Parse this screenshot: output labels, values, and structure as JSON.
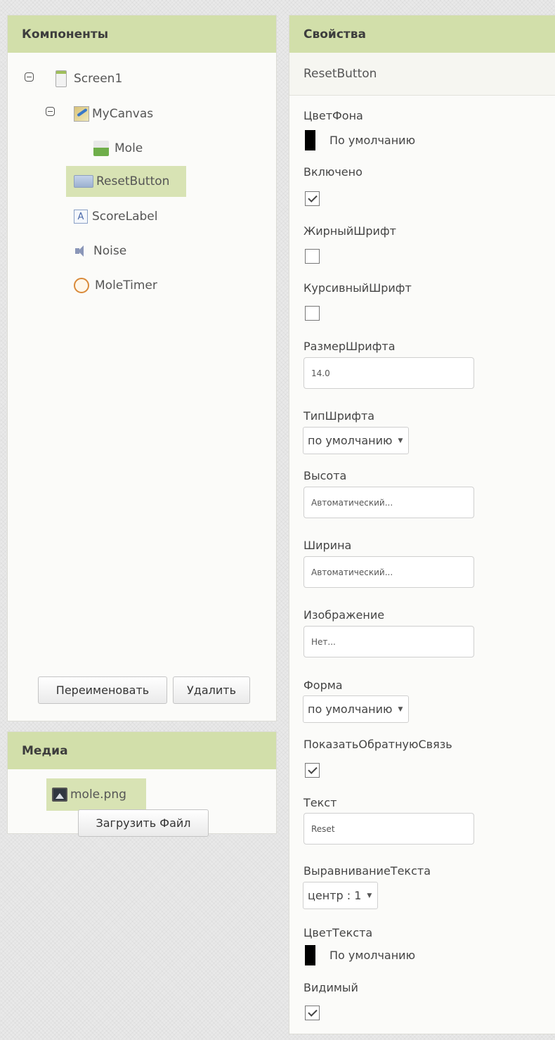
{
  "components_panel": {
    "title": "Компоненты",
    "tree": [
      {
        "label": "Screen1",
        "icon": "screen-icon"
      },
      {
        "label": "MyCanvas",
        "icon": "canvas-icon"
      },
      {
        "label": "Mole",
        "icon": "image-sprite-icon"
      },
      {
        "label": "ResetButton",
        "icon": "button-icon",
        "selected": true
      },
      {
        "label": "ScoreLabel",
        "icon": "label-icon"
      },
      {
        "label": "Noise",
        "icon": "sound-icon"
      },
      {
        "label": "MoleTimer",
        "icon": "clock-icon"
      }
    ],
    "rename_button": "Переименовать",
    "delete_button": "Удалить"
  },
  "media_panel": {
    "title": "Медиа",
    "files": [
      {
        "label": "mole.png",
        "icon": "image-file-icon"
      }
    ],
    "upload_button": "Загрузить Файл"
  },
  "properties_panel": {
    "title": "Свойства",
    "component_name": "ResetButton",
    "background_color": {
      "label": "ЦветФона",
      "value": "По умолчанию",
      "color": "#000000"
    },
    "enabled": {
      "label": "Включено",
      "checked": true
    },
    "font_bold": {
      "label": "ЖирныйШрифт",
      "checked": false
    },
    "font_italic": {
      "label": "КурсивныйШрифт",
      "checked": false
    },
    "font_size": {
      "label": "РазмерШрифта",
      "value": "14.0"
    },
    "font_typeface": {
      "label": "ТипШрифта",
      "value": "по умолчанию"
    },
    "height": {
      "label": "Высота",
      "value": "Автоматический..."
    },
    "width": {
      "label": "Ширина",
      "value": "Автоматический..."
    },
    "image": {
      "label": "Изображение",
      "value": "Нет..."
    },
    "shape": {
      "label": "Форма",
      "value": "по умолчанию"
    },
    "show_feedback": {
      "label": "ПоказатьОбратнуюСвязь",
      "checked": true
    },
    "text": {
      "label": "Текст",
      "value": "Reset"
    },
    "text_alignment": {
      "label": "ВыравниваниеТекста",
      "value": "центр : 1"
    },
    "text_color": {
      "label": "ЦветТекста",
      "value": "По умолчанию",
      "color": "#000000"
    },
    "visible": {
      "label": "Видимый",
      "checked": true
    }
  },
  "colors": {
    "header_bg": "#d2dfaa",
    "selected_bg": "#d8e3b4"
  }
}
